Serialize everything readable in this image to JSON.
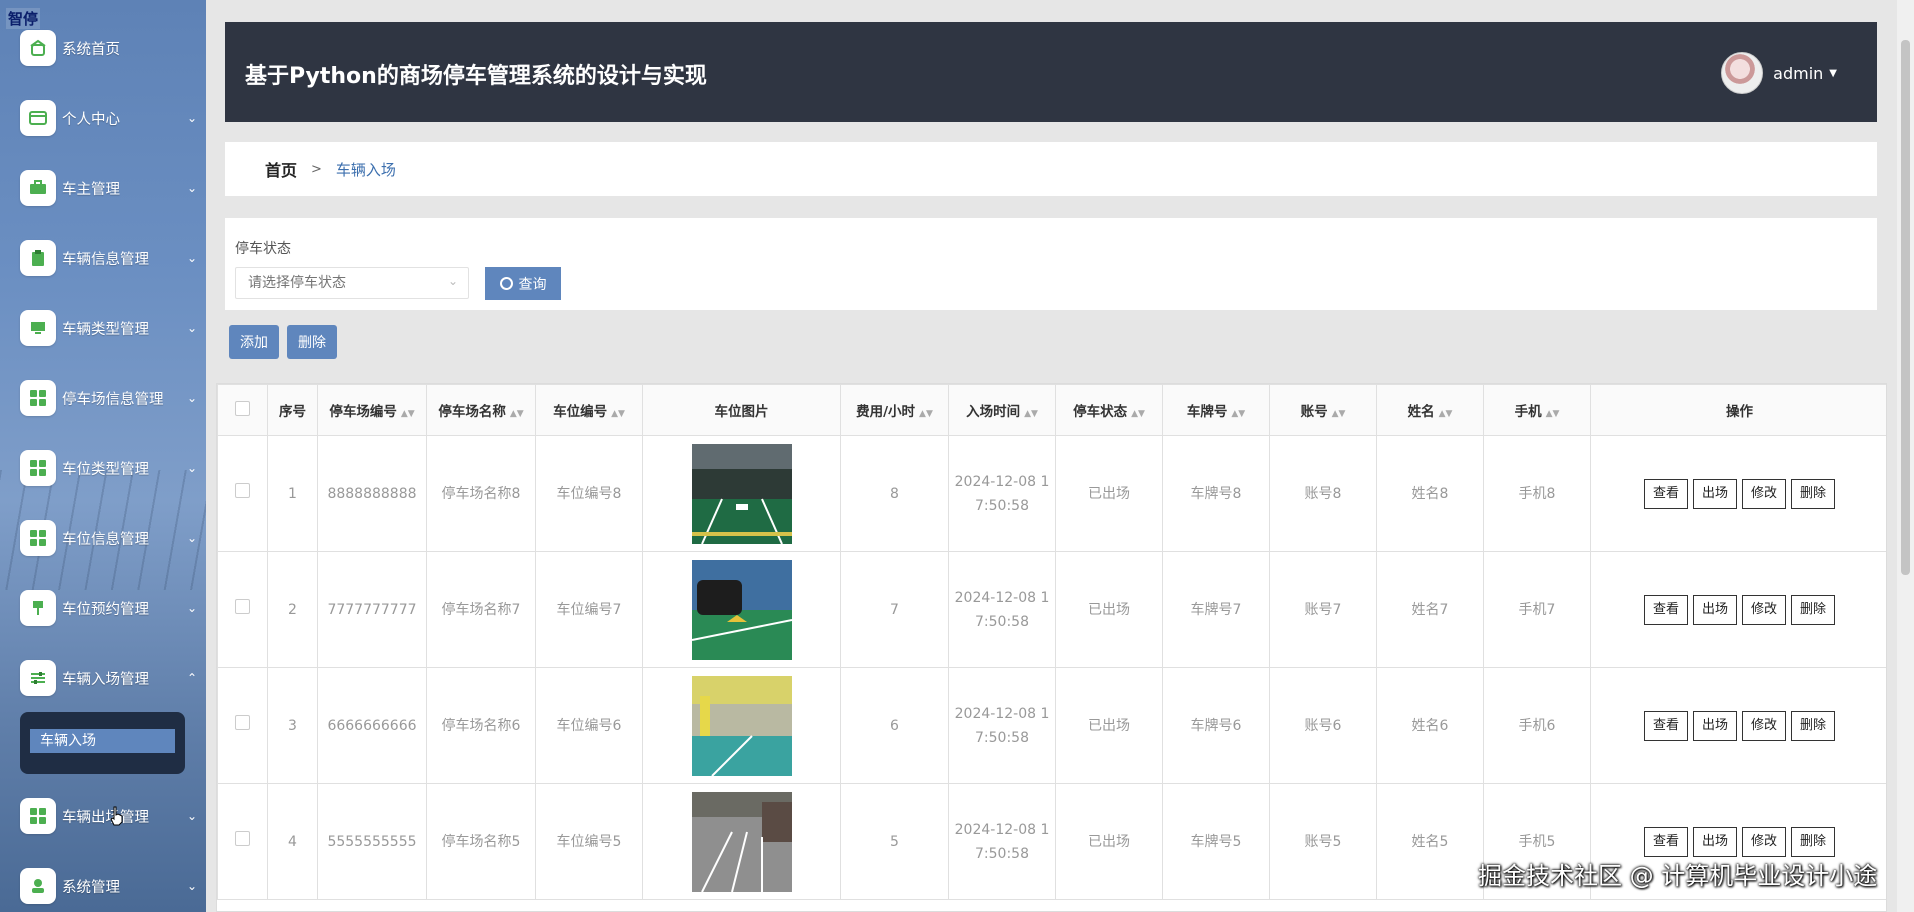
{
  "app": {
    "brand": "智停",
    "title": "基于Python的商场停车管理系统的设计与实现",
    "user": "admin"
  },
  "sidebar": {
    "items": [
      {
        "label": "系统首页",
        "icon": "home-icon"
      },
      {
        "label": "个人中心",
        "icon": "card-icon"
      },
      {
        "label": "车主管理",
        "icon": "briefcase-icon"
      },
      {
        "label": "车辆信息管理",
        "icon": "clipboard-icon"
      },
      {
        "label": "车辆类型管理",
        "icon": "monitor-icon"
      },
      {
        "label": "停车场信息管理",
        "icon": "grid-icon"
      },
      {
        "label": "车位类型管理",
        "icon": "grid-icon"
      },
      {
        "label": "车位信息管理",
        "icon": "grid-icon"
      },
      {
        "label": "车位预约管理",
        "icon": "pin-icon"
      },
      {
        "label": "车辆入场管理",
        "icon": "sliders-icon"
      },
      {
        "label": "车辆出场管理",
        "icon": "grid-icon"
      },
      {
        "label": "系统管理",
        "icon": "person-icon"
      }
    ],
    "active_sub": "车辆入场"
  },
  "breadcrumb": {
    "home": "首页",
    "sep": ">",
    "current": "车辆入场"
  },
  "search": {
    "label": "停车状态",
    "placeholder": "请选择停车状态",
    "button": "查询"
  },
  "actions": {
    "add": "添加",
    "delete": "删除"
  },
  "table": {
    "headers": [
      "序号",
      "停车场编号",
      "停车场名称",
      "车位编号",
      "车位图片",
      "费用/小时",
      "入场时间",
      "停车状态",
      "车牌号",
      "账号",
      "姓名",
      "手机",
      "操作"
    ],
    "row_actions": [
      "查看",
      "出场",
      "修改",
      "删除"
    ],
    "rows": [
      {
        "idx": "1",
        "lot_no": "8888888888",
        "lot_name": "停车场名称8",
        "space_no": "车位编号8",
        "fee": "8",
        "time_a": "2024-12-08 1",
        "time_b": "7:50:58",
        "status": "已出场",
        "plate": "车牌号8",
        "account": "账号8",
        "name": "姓名8",
        "phone": "手机8"
      },
      {
        "idx": "2",
        "lot_no": "7777777777",
        "lot_name": "停车场名称7",
        "space_no": "车位编号7",
        "fee": "7",
        "time_a": "2024-12-08 1",
        "time_b": "7:50:58",
        "status": "已出场",
        "plate": "车牌号7",
        "account": "账号7",
        "name": "姓名7",
        "phone": "手机7"
      },
      {
        "idx": "3",
        "lot_no": "6666666666",
        "lot_name": "停车场名称6",
        "space_no": "车位编号6",
        "fee": "6",
        "time_a": "2024-12-08 1",
        "time_b": "7:50:58",
        "status": "已出场",
        "plate": "车牌号6",
        "account": "账号6",
        "name": "姓名6",
        "phone": "手机6"
      },
      {
        "idx": "4",
        "lot_no": "5555555555",
        "lot_name": "停车场名称5",
        "space_no": "车位编号5",
        "fee": "5",
        "time_a": "2024-12-08 1",
        "time_b": "7:50:58",
        "status": "已出场",
        "plate": "车牌号5",
        "account": "账号5",
        "name": "姓名5",
        "phone": "手机5"
      }
    ]
  },
  "watermark": "掘金技术社区 @ 计算机毕业设计小途",
  "colors": {
    "header_bg": "#2f3542",
    "accent": "#5f86bd",
    "link": "#3c6fae",
    "submenu_bg": "#1f2d44"
  }
}
